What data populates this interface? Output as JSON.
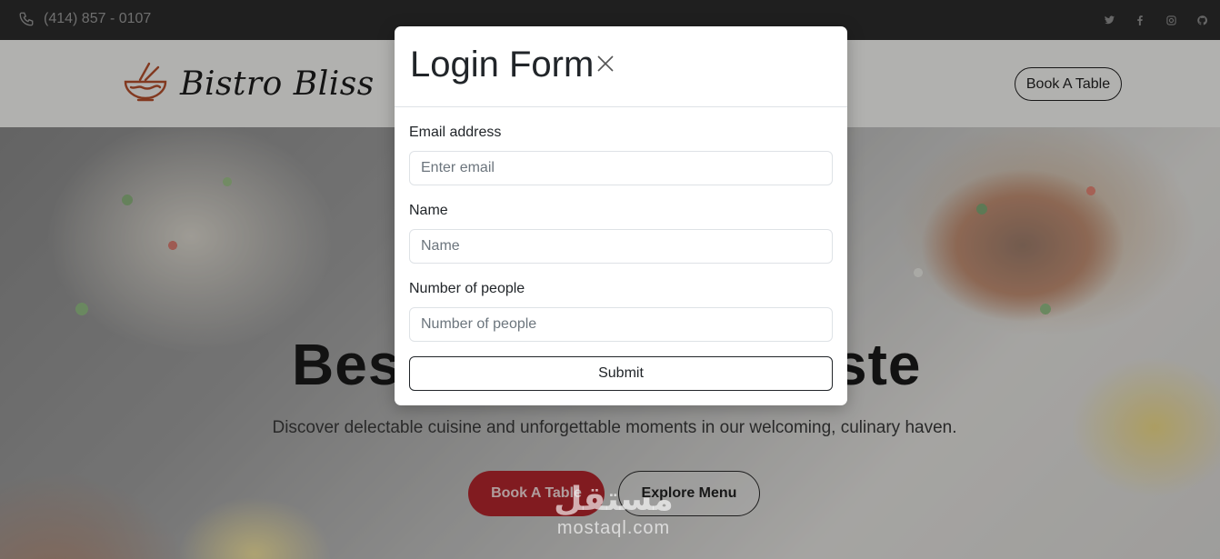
{
  "topbar": {
    "phone": "(414) 857 - 0107",
    "phone_icon": "phone-icon",
    "socials": [
      {
        "icon": "twitter-icon",
        "glyph": "🐦"
      },
      {
        "icon": "facebook-icon",
        "glyph": "f"
      },
      {
        "icon": "instagram-icon",
        "glyph": "◎"
      },
      {
        "icon": "github-icon",
        "glyph": "●"
      }
    ]
  },
  "navbar": {
    "brand_name": "Bistro Bliss",
    "logo_icon": "bowl-chopsticks-icon",
    "book_label": "Book A Table"
  },
  "hero": {
    "title_left": "Bes",
    "title_right": "ste",
    "subtitle": "Discover delectable cuisine and unforgettable moments in our welcoming, culinary haven.",
    "book_label": "Book A Table",
    "menu_label": "Explore Menu"
  },
  "modal": {
    "title": "Login Form",
    "close_icon": "close-icon",
    "fields": [
      {
        "label": "Email address",
        "placeholder": "Enter email"
      },
      {
        "label": "Name",
        "placeholder": "Name"
      },
      {
        "label": "Number of people",
        "placeholder": "Number of people"
      }
    ],
    "submit_label": "Submit"
  },
  "watermark": {
    "arabic": "مستقل",
    "latin": "mostaql.com"
  },
  "colors": {
    "accent": "#b3262d",
    "topbar_bg": "#2b2b2b"
  }
}
